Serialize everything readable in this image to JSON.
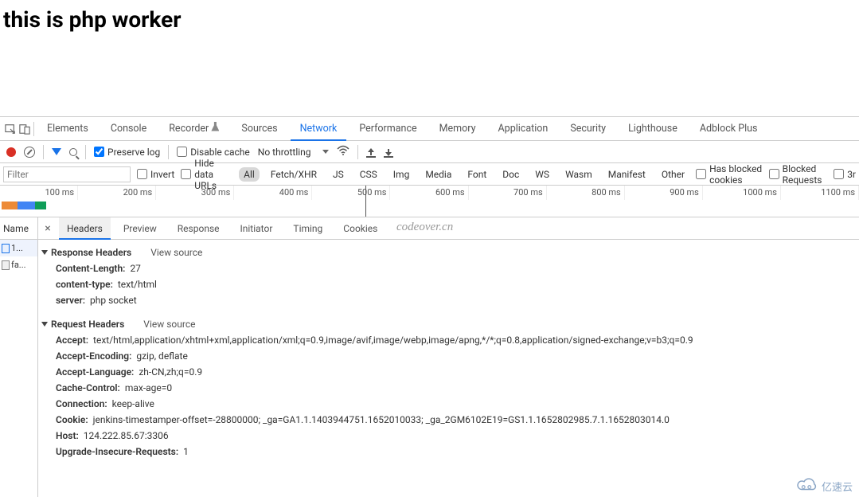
{
  "page": {
    "heading": "this is php worker"
  },
  "devtools_tabs": [
    "Elements",
    "Console",
    "Recorder",
    "Sources",
    "Network",
    "Performance",
    "Memory",
    "Application",
    "Security",
    "Lighthouse",
    "Adblock Plus"
  ],
  "devtools_active_tab": "Network",
  "toolbar": {
    "preserve_log": "Preserve log",
    "preserve_log_checked": true,
    "disable_cache": "Disable cache",
    "disable_cache_checked": false,
    "throttling": "No throttling"
  },
  "filter_row": {
    "filter_placeholder": "Filter",
    "invert": "Invert",
    "hide_data_urls": "Hide data URLs",
    "types": [
      "All",
      "Fetch/XHR",
      "JS",
      "CSS",
      "Img",
      "Media",
      "Font",
      "Doc",
      "WS",
      "Wasm",
      "Manifest",
      "Other"
    ],
    "active_type": "All",
    "has_blocked_cookies": "Has blocked cookies",
    "blocked_requests": "Blocked Requests",
    "third_party": "3r"
  },
  "overview_ticks": [
    "100 ms",
    "200 ms",
    "300 ms",
    "400 ms",
    "500 ms",
    "600 ms",
    "700 ms",
    "800 ms",
    "900 ms",
    "1000 ms",
    "1100 ms"
  ],
  "name_column": {
    "header": "Name",
    "rows": [
      "1...",
      "fa..."
    ]
  },
  "detail_tabs": [
    "Headers",
    "Preview",
    "Response",
    "Initiator",
    "Timing",
    "Cookies"
  ],
  "detail_active": "Headers",
  "watermark": "codeover.cn",
  "headers": {
    "response": {
      "title": "Response Headers",
      "view_source": "View source",
      "items": [
        {
          "k": "Content-Length:",
          "v": "27"
        },
        {
          "k": "content-type:",
          "v": "text/html"
        },
        {
          "k": "server:",
          "v": "php socket"
        }
      ]
    },
    "request": {
      "title": "Request Headers",
      "view_source": "View source",
      "items": [
        {
          "k": "Accept:",
          "v": "text/html,application/xhtml+xml,application/xml;q=0.9,image/avif,image/webp,image/apng,*/*;q=0.8,application/signed-exchange;v=b3;q=0.9"
        },
        {
          "k": "Accept-Encoding:",
          "v": "gzip, deflate"
        },
        {
          "k": "Accept-Language:",
          "v": "zh-CN,zh;q=0.9"
        },
        {
          "k": "Cache-Control:",
          "v": "max-age=0"
        },
        {
          "k": "Connection:",
          "v": "keep-alive"
        },
        {
          "k": "Cookie:",
          "v": "jenkins-timestamper-offset=-28800000; _ga=GA1.1.1403944751.1652010033; _ga_2GM6102E19=GS1.1.1652802985.7.1.1652803014.0"
        },
        {
          "k": "Host:",
          "v": "124.222.85.67:3306"
        },
        {
          "k": "Upgrade-Insecure-Requests:",
          "v": "1"
        }
      ]
    }
  },
  "brand": "亿速云"
}
